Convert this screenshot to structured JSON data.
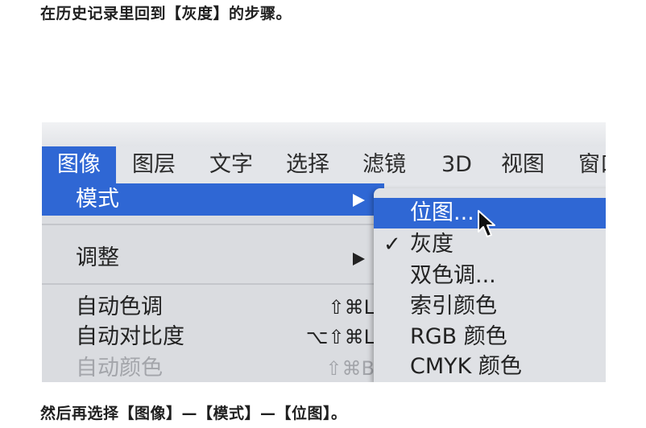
{
  "article": {
    "intro": "在历史记录里回到【灰度】的步骤。",
    "outro": "然后再选择【图像】—【模式】—【位图】。"
  },
  "menubar": {
    "items": [
      {
        "label": "图像",
        "active": true
      },
      {
        "label": "图层"
      },
      {
        "label": "文字"
      },
      {
        "label": "选择"
      },
      {
        "label": "滤镜"
      },
      {
        "label": "3D"
      },
      {
        "label": "视图"
      },
      {
        "label": "窗口"
      }
    ]
  },
  "image_menu": {
    "items": [
      {
        "label": "模式",
        "submenu": true,
        "highlighted": true
      },
      {
        "label": "调整",
        "submenu": true
      },
      {
        "label": "自动色调",
        "shortcut": "⇧⌘L"
      },
      {
        "label": "自动对比度",
        "shortcut": "⌥⇧⌘L"
      },
      {
        "label": "自动颜色",
        "shortcut": "⇧⌘B",
        "disabled": true
      }
    ]
  },
  "mode_submenu": {
    "items": [
      {
        "label": "位图...",
        "highlighted": true
      },
      {
        "label": "灰度",
        "checked": true,
        "check_mark": "✓"
      },
      {
        "label": "双色调..."
      },
      {
        "label": "索引颜色"
      },
      {
        "label": "RGB 颜色"
      },
      {
        "label": "CMYK 颜色"
      }
    ]
  },
  "colors": {
    "highlight": "#2f67d4",
    "menu_background": "#dadce0",
    "disabled_text": "#a3a5aa"
  }
}
